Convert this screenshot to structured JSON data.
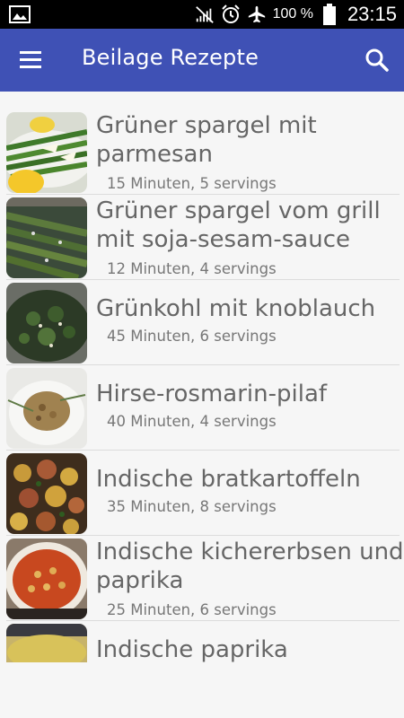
{
  "status_bar": {
    "battery_percent": "100 %",
    "time": "23:15",
    "icons": [
      "image-icon",
      "signal-off-icon",
      "alarm-icon",
      "airplane-mode-icon",
      "battery-icon"
    ]
  },
  "app_bar": {
    "title": "Beilage Rezepte",
    "menu_icon": "hamburger-menu-icon",
    "search_icon": "search-icon"
  },
  "colors": {
    "primary": "#3f51b5",
    "background": "#f6f6f6",
    "title_text": "#666666",
    "meta_text": "#777777"
  },
  "recipes": [
    {
      "title_line1": "Grüner spargel mit",
      "title_line2": "parmesan",
      "meta": "15 Minuten, 5 servings"
    },
    {
      "title_line1": "Grüner spargel vom grill",
      "title_line2": "mit soja-sesam-sauce",
      "meta": "12 Minuten, 4 servings"
    },
    {
      "title_line1": "Grünkohl mit knoblauch",
      "title_line2": "",
      "meta": "45 Minuten, 6 servings"
    },
    {
      "title_line1": "Hirse-rosmarin-pilaf",
      "title_line2": "",
      "meta": "40 Minuten, 4 servings"
    },
    {
      "title_line1": "Indische bratkartoffeln",
      "title_line2": "",
      "meta": "35 Minuten, 8 servings"
    },
    {
      "title_line1": "Indische kichererbsen und",
      "title_line2": "paprika",
      "meta": "25 Minuten, 6 servings"
    },
    {
      "title_line1": "Indische paprika",
      "title_line2": "",
      "meta": ""
    }
  ]
}
